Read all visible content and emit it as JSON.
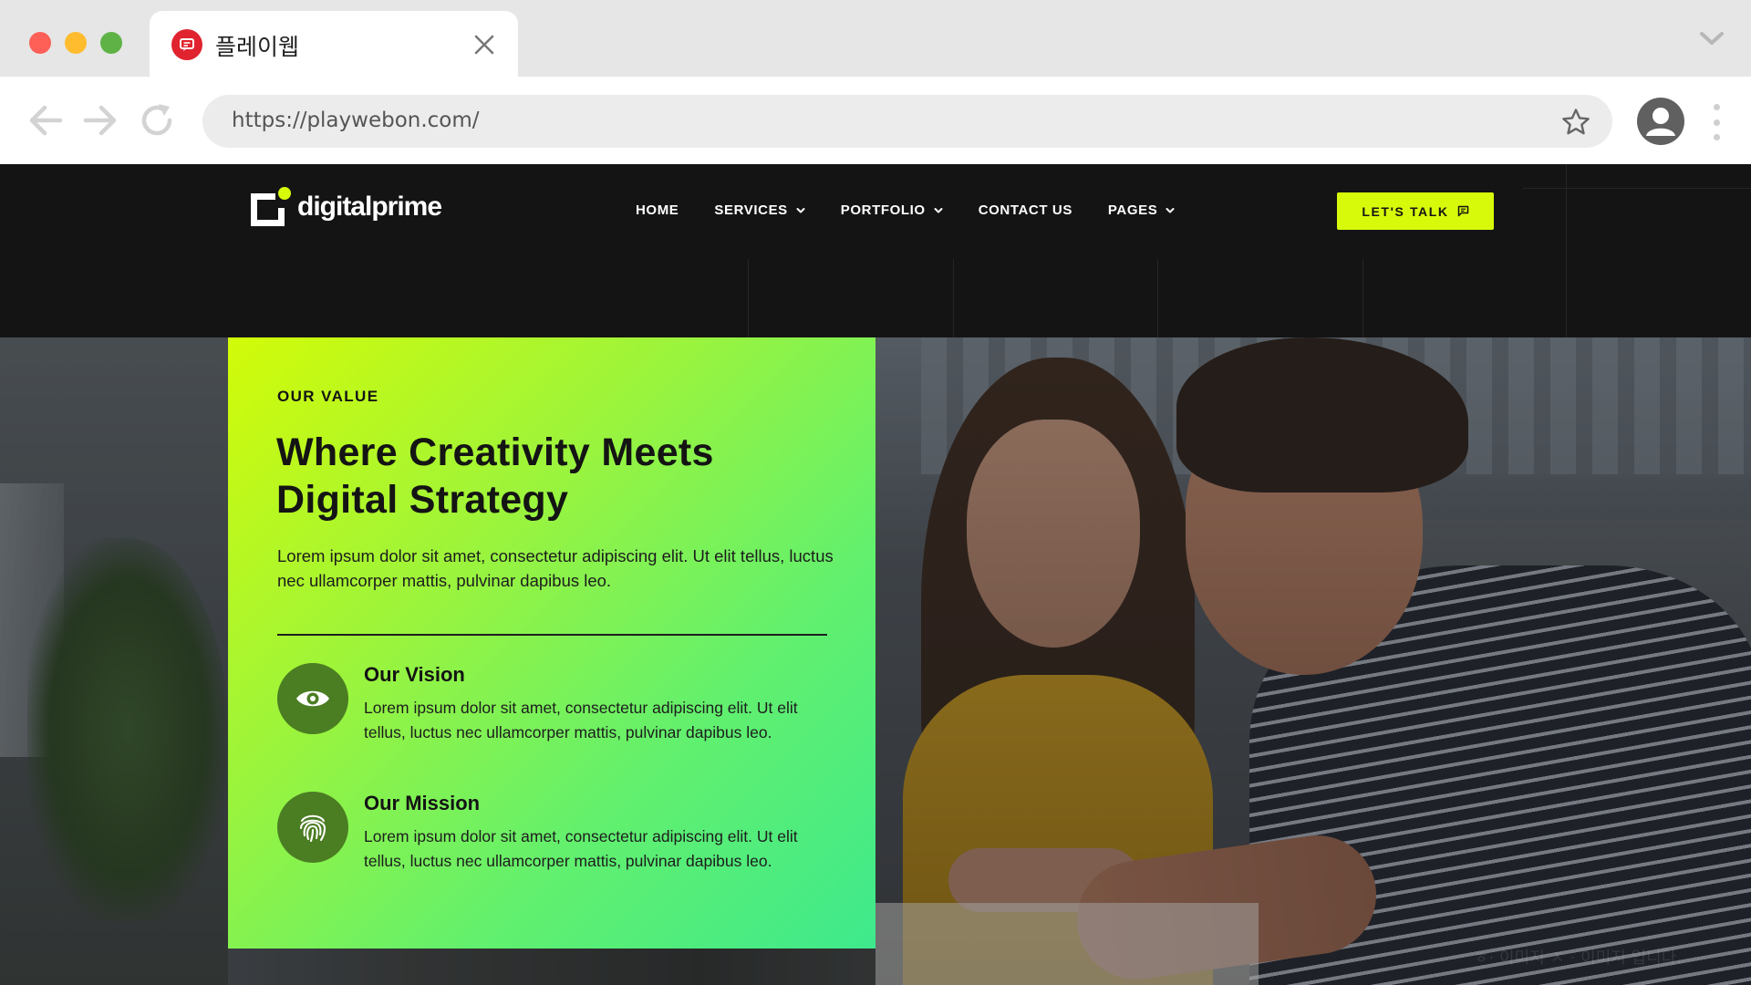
{
  "browser": {
    "tab": {
      "title": "플레이웹"
    },
    "address_bar": {
      "url": "https://playwebon.com/"
    }
  },
  "site": {
    "logo_text": "digitalprime",
    "nav": {
      "items": [
        {
          "label": "HOME",
          "has_dropdown": false
        },
        {
          "label": "SERVICES",
          "has_dropdown": true
        },
        {
          "label": "PORTFOLIO",
          "has_dropdown": true
        },
        {
          "label": "CONTACT US",
          "has_dropdown": false
        },
        {
          "label": "PAGES",
          "has_dropdown": true
        }
      ]
    },
    "cta_label": "LET'S TALK",
    "hero": {
      "eyebrow": "OUR VALUE",
      "headline_line1": "Where Creativity Meets",
      "headline_line2": "Digital Strategy",
      "lead": "Lorem ipsum dolor sit amet, consectetur adipiscing elit. Ut elit tellus, luctus nec ullamcorper mattis, pulvinar dapibus leo.",
      "features": [
        {
          "icon": "eye-icon",
          "title": "Our Vision",
          "text": "Lorem ipsum dolor sit amet, consectetur adipiscing elit. Ut elit tellus, luctus nec ullamcorper mattis, pulvinar dapibus leo."
        },
        {
          "icon": "fingerprint-icon",
          "title": "Our Mission",
          "text": "Lorem ipsum dolor sit amet, consectetur adipiscing elit. Ut elit tellus, luctus nec ullamcorper mattis, pulvinar dapibus leo."
        }
      ],
      "watermark": "ㅎ·  이미지 ㅈ  ·  이미지 입니다."
    }
  },
  "colors": {
    "accent": "#d7fa0a",
    "header_bg": "#141414",
    "card_gradient_start": "#d2fb08",
    "card_gradient_end": "#3ee98c",
    "feature_icon_bg": "#4b7d23"
  }
}
